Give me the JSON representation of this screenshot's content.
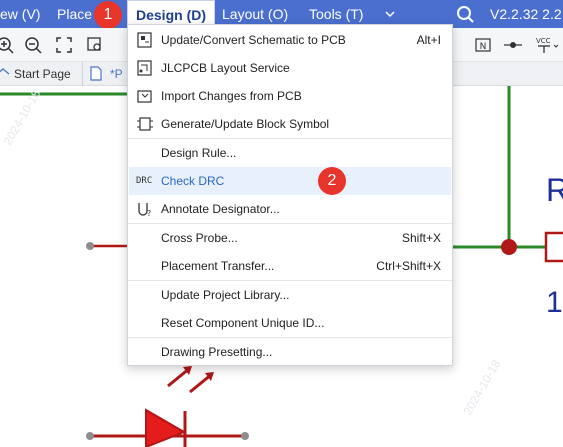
{
  "menubar": {
    "items": [
      "ew (V)",
      "Place",
      "Design (D)",
      "Layout (O)",
      "Tools (T)"
    ],
    "version": "V2.2.32 2.2",
    "step1": "1"
  },
  "tabs": {
    "start": "Start Page",
    "current": "*P"
  },
  "menu": {
    "items": [
      {
        "label": "Update/Convert Schematic to PCB",
        "shortcut": "Alt+I"
      },
      {
        "label": "JLCPCB Layout Service",
        "shortcut": ""
      },
      {
        "label": "Import Changes from PCB",
        "shortcut": ""
      },
      {
        "label": "Generate/Update Block Symbol",
        "shortcut": ""
      },
      {
        "label": "Design Rule...",
        "shortcut": ""
      },
      {
        "label": "Check DRC",
        "shortcut": ""
      },
      {
        "label": "Annotate Designator...",
        "shortcut": ""
      },
      {
        "label": "Cross Probe...",
        "shortcut": "Shift+X"
      },
      {
        "label": "Placement Transfer...",
        "shortcut": "Ctrl+Shift+X"
      },
      {
        "label": "Update Project Library...",
        "shortcut": ""
      },
      {
        "label": "Reset Component Unique ID...",
        "shortcut": ""
      },
      {
        "label": "Drawing Presetting...",
        "shortcut": ""
      }
    ],
    "drc_icon": "DRC",
    "step2": "2"
  },
  "canvas": {
    "ref_text": "R",
    "value_text": "1"
  },
  "toolbar": {
    "vcc": "VCC",
    "n": "N"
  },
  "colors": {
    "menubar": "#4a6fcf",
    "highlight": "#2a68c5",
    "badge": "#e8352b",
    "wire": "#2a8a2a",
    "part": "#b01717"
  }
}
